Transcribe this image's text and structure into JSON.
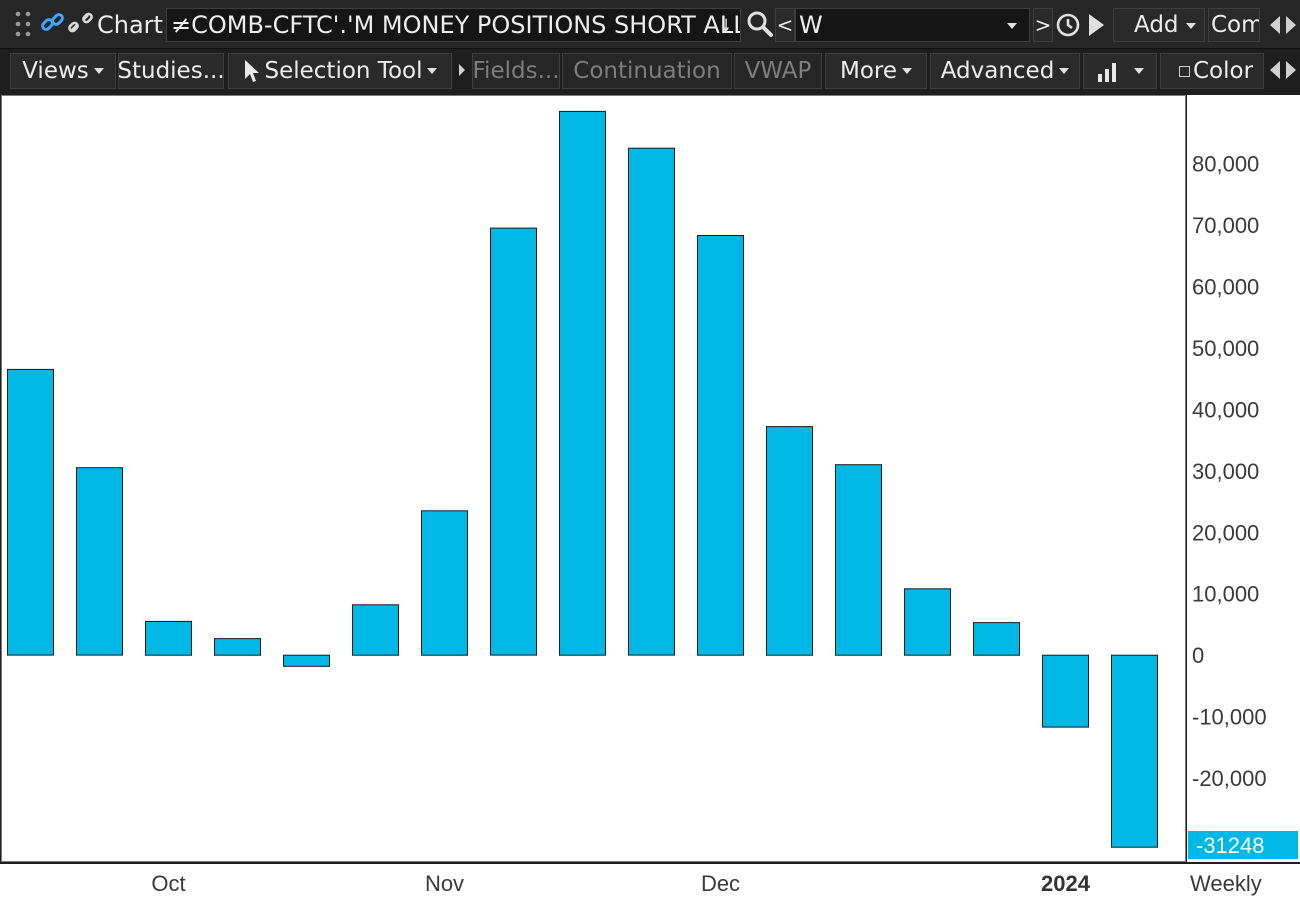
{
  "toolbar": {
    "chart_label": "Chart",
    "symbol": "≠COMB-CFTC'.'M MONEY POSITIONS SHORT ALL'",
    "less_sign": "<",
    "aggregation": "W",
    "greater_sign": ">",
    "add_label": "Add",
    "com_label": "Com"
  },
  "menu": {
    "views": "Views",
    "studies": "Studies...",
    "selection_tool": "Selection Tool",
    "fields": "Fields...",
    "continuation": "Continuation",
    "vwap": "VWAP",
    "more": "More",
    "advanced": "Advanced",
    "color": "Color"
  },
  "colors": {
    "bar_fill": "#00b8e6",
    "bar_stroke": "#1a1a1a",
    "price_tag": "#00b8e6"
  },
  "chart_data": {
    "type": "bar",
    "values": [
      46500,
      30500,
      5500,
      2700,
      -1800,
      8200,
      23500,
      69500,
      88500,
      82500,
      68300,
      37200,
      31000,
      10800,
      5300,
      -11700,
      -31248
    ],
    "ylim": [
      -33500,
      91000
    ],
    "yticks": [
      -20000,
      -10000,
      0,
      10000,
      20000,
      30000,
      40000,
      50000,
      60000,
      70000,
      80000
    ],
    "ytick_labels": [
      "-20,000",
      "-10,000",
      "0",
      "10,000",
      "20,000",
      "30,000",
      "40,000",
      "50,000",
      "60,000",
      "70,000",
      "80,000"
    ],
    "x_labels": [
      {
        "label": "Oct",
        "bar_index": 2,
        "bold": false
      },
      {
        "label": "Nov",
        "bar_index": 6,
        "bold": false
      },
      {
        "label": "Dec",
        "bar_index": 10,
        "bold": false
      },
      {
        "label": "2024",
        "bar_index": 15,
        "bold": true
      }
    ],
    "last_value_label": "-31248",
    "period_label": "Weekly",
    "grid": false
  }
}
